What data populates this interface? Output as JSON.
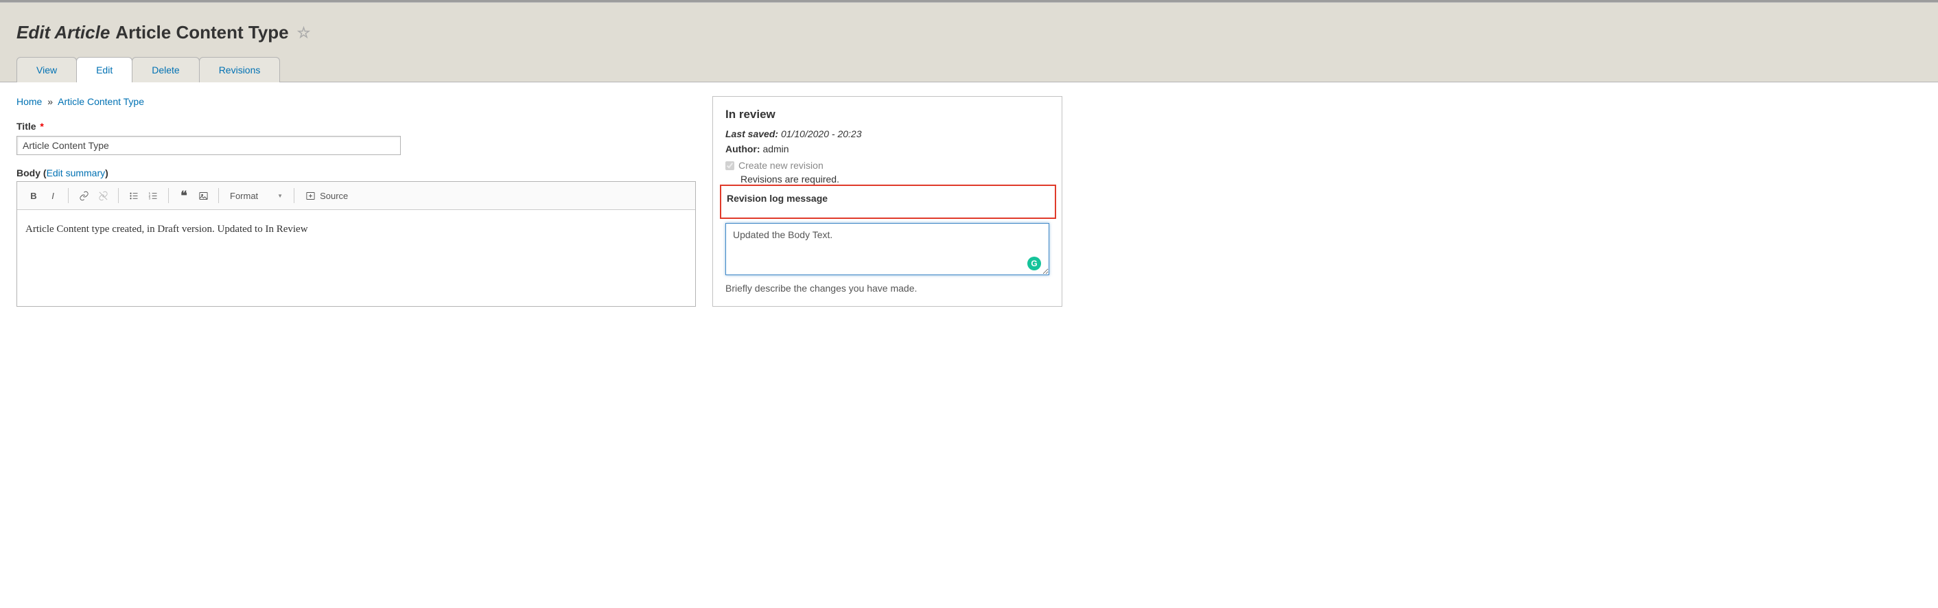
{
  "page": {
    "title_prefix": "Edit Article",
    "title_name": "Article Content Type"
  },
  "tabs": {
    "view": "View",
    "edit": "Edit",
    "delete": "Delete",
    "revisions": "Revisions",
    "active": "edit"
  },
  "breadcrumb": {
    "home": "Home",
    "current": "Article Content Type"
  },
  "title_field": {
    "label": "Title",
    "value": "Article Content Type"
  },
  "body_field": {
    "label": "Body",
    "edit_summary_link": "Edit summary",
    "content": "Article Content type created, in Draft version. Updated to In Review"
  },
  "toolbar": {
    "bold": "B",
    "italic": "I",
    "format_label": "Format",
    "source_label": "Source"
  },
  "sidebar": {
    "status": "In review",
    "last_saved_label": "Last saved:",
    "last_saved_value": "01/10/2020 - 20:23",
    "author_label": "Author:",
    "author_value": "admin",
    "create_revision_label": "Create new revision",
    "create_revision_checked": true,
    "revisions_required": "Revisions are required.",
    "revision_log_label": "Revision log message",
    "revision_log_value": "Updated the Body Text.",
    "help_text": "Briefly describe the changes you have made."
  }
}
